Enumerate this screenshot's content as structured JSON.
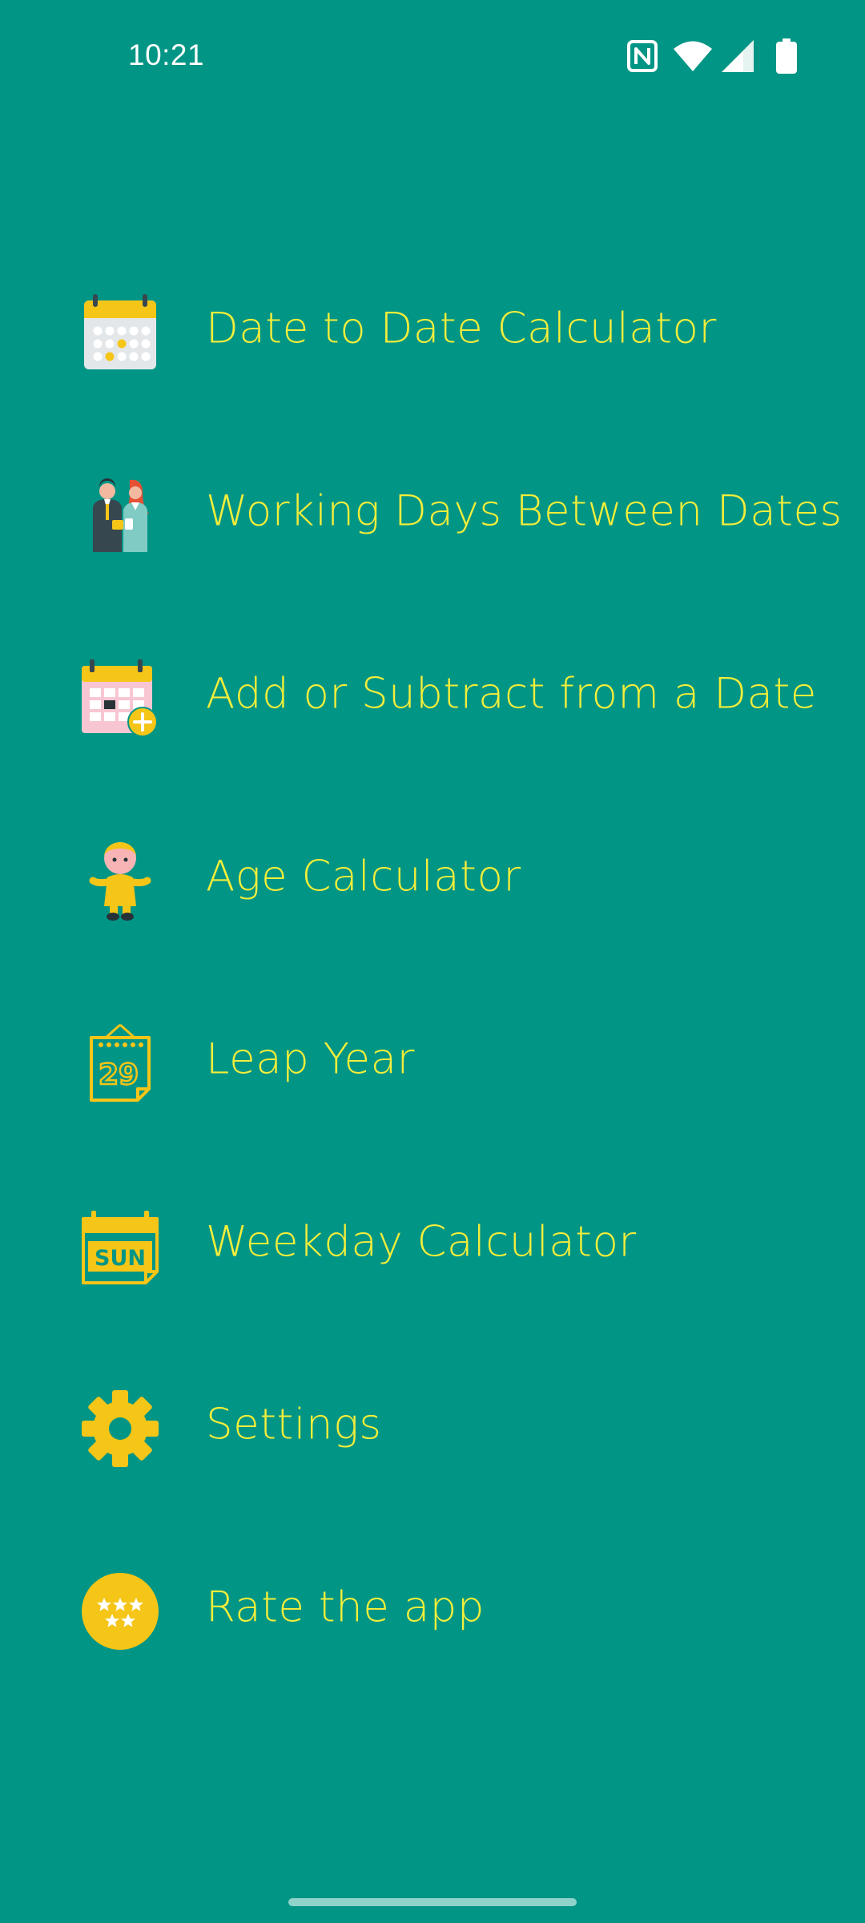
{
  "status_bar": {
    "time": "10:21",
    "icons": [
      "nfc-icon",
      "wifi-icon",
      "signal-icon",
      "battery-icon"
    ],
    "color": "#ffffff"
  },
  "theme": {
    "background": "#009585",
    "label_color": "#f4ee3a",
    "icon_yellow": "#f5c518"
  },
  "menu": {
    "items": [
      {
        "label": "Date to Date Calculator",
        "icon": "calendar-icon"
      },
      {
        "label": "Working Days Between Dates",
        "icon": "business-people-icon"
      },
      {
        "label": "Add or Subtract from a Date",
        "icon": "calendar-add-icon"
      },
      {
        "label": "Age Calculator",
        "icon": "baby-icon"
      },
      {
        "label": "Leap Year",
        "icon": "leap-year-calendar-icon"
      },
      {
        "label": "Weekday Calculator",
        "icon": "weekday-calendar-icon"
      },
      {
        "label": "Settings",
        "icon": "gear-icon"
      },
      {
        "label": "Rate the app",
        "icon": "stars-icon"
      }
    ]
  },
  "icon_text": {
    "leap_day": "29",
    "weekday": "SUN"
  }
}
